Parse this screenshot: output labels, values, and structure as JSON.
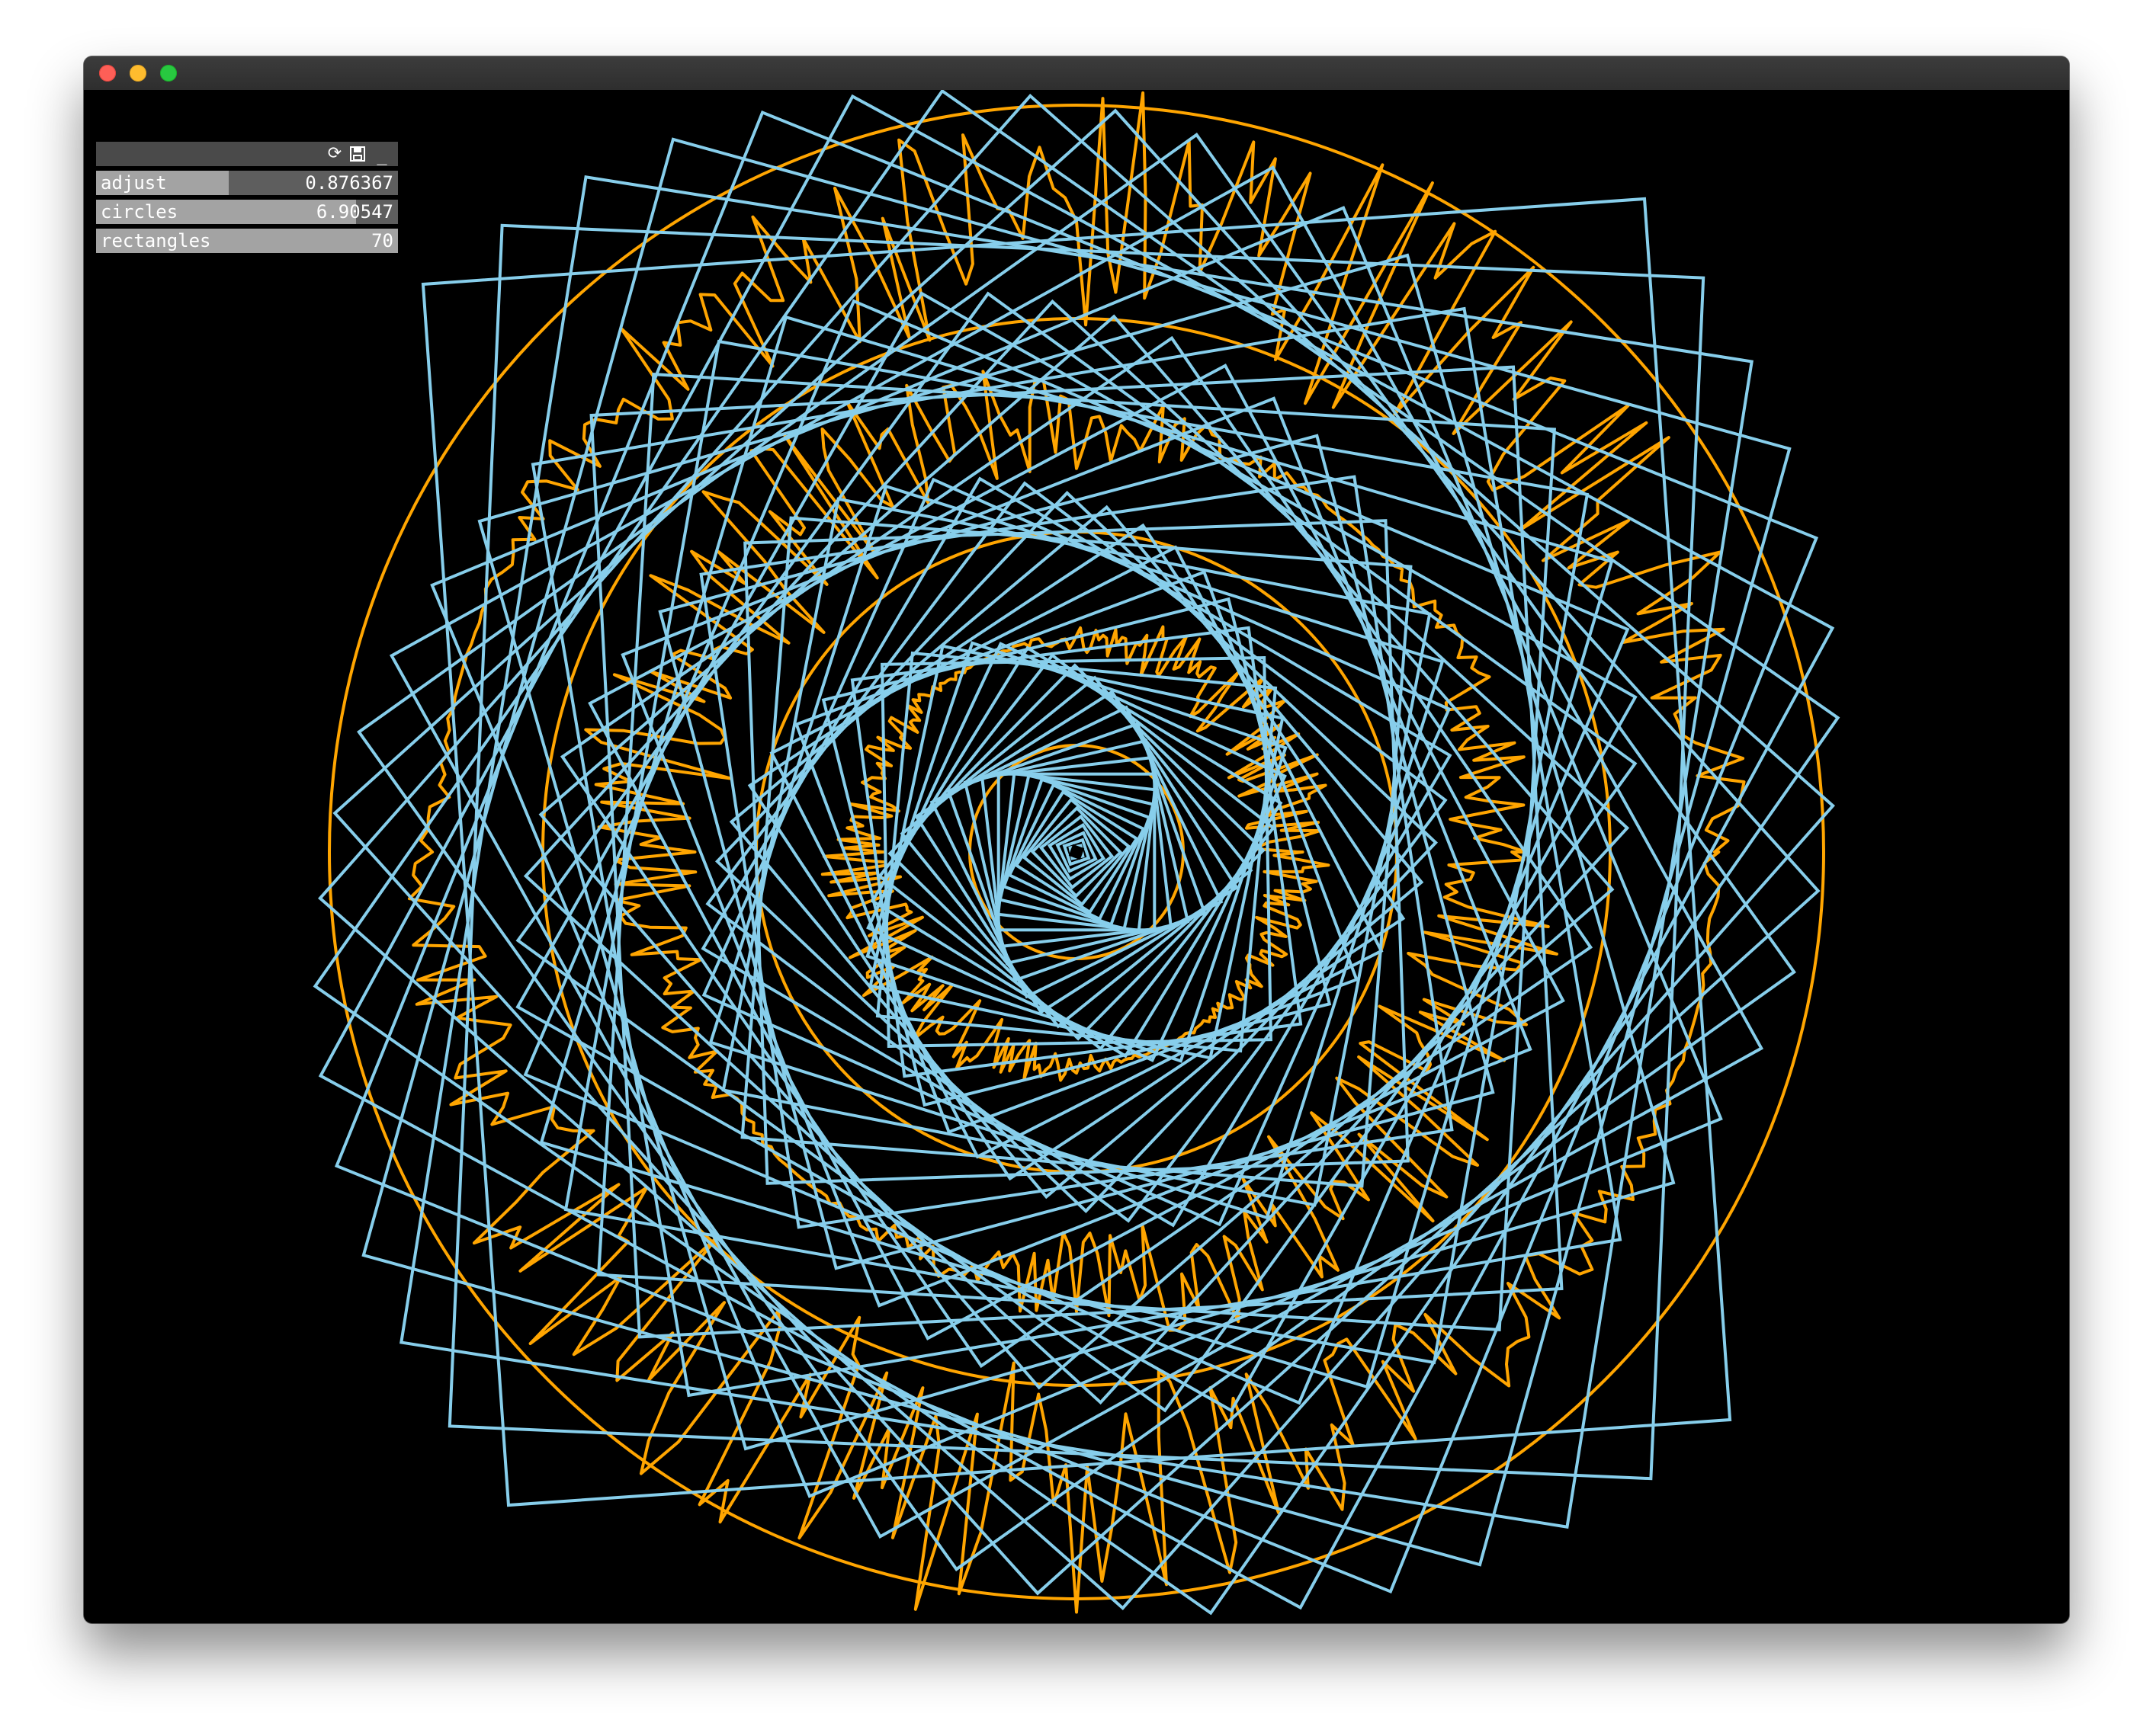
{
  "window": {
    "controls": {
      "close": "close-button",
      "minimize": "minimize-button",
      "zoom": "zoom-button"
    }
  },
  "gui": {
    "header_icons": {
      "reload": "⟳",
      "save": "💾",
      "minimize": "_"
    },
    "params": [
      {
        "name": "adjust",
        "value": "0.876367",
        "fraction": 0.44
      },
      {
        "name": "circles",
        "value": "6.90547",
        "fraction": 0.86
      },
      {
        "name": "rectangles",
        "value": "70",
        "fraction": 1.0
      }
    ]
  },
  "visual": {
    "circle_color": "#FFA500",
    "rectangle_color": "#87CEEB",
    "background": "#000000",
    "circle_count": 7,
    "rectangle_count": 70
  }
}
